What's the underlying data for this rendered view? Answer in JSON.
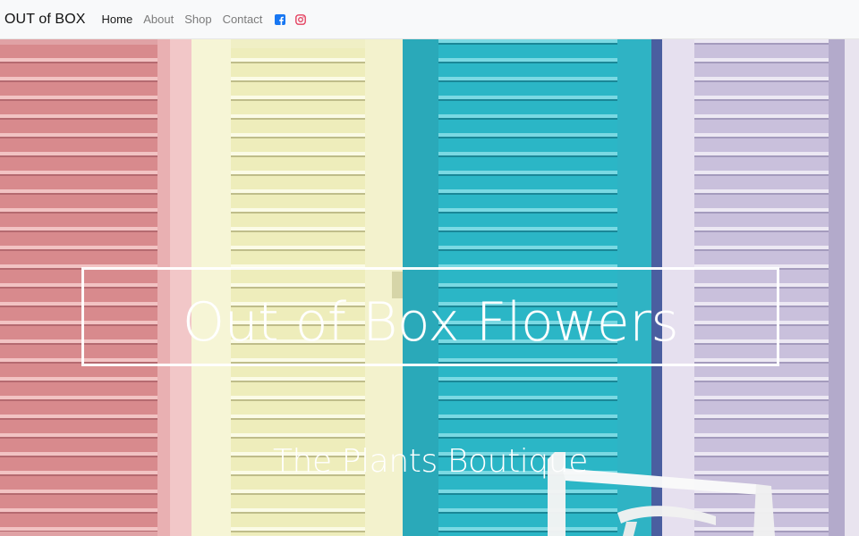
{
  "navbar": {
    "brand": "OUT of BOX",
    "links": [
      {
        "label": "Home",
        "active": true
      },
      {
        "label": "About",
        "active": false
      },
      {
        "label": "Shop",
        "active": false
      },
      {
        "label": "Contact",
        "active": false
      }
    ],
    "social": [
      {
        "icon": "facebook-icon",
        "color": "#1877f2"
      },
      {
        "icon": "instagram-icon",
        "color": "#e4405f"
      }
    ]
  },
  "hero": {
    "title": "Out of Box Flowers",
    "subtitle": "The Plants Boutique",
    "image_description_colors": {
      "pink": "#d98f92",
      "yellow": "#efeebf",
      "teal": "#2fb7c8",
      "lavender": "#c7bfd9"
    }
  }
}
